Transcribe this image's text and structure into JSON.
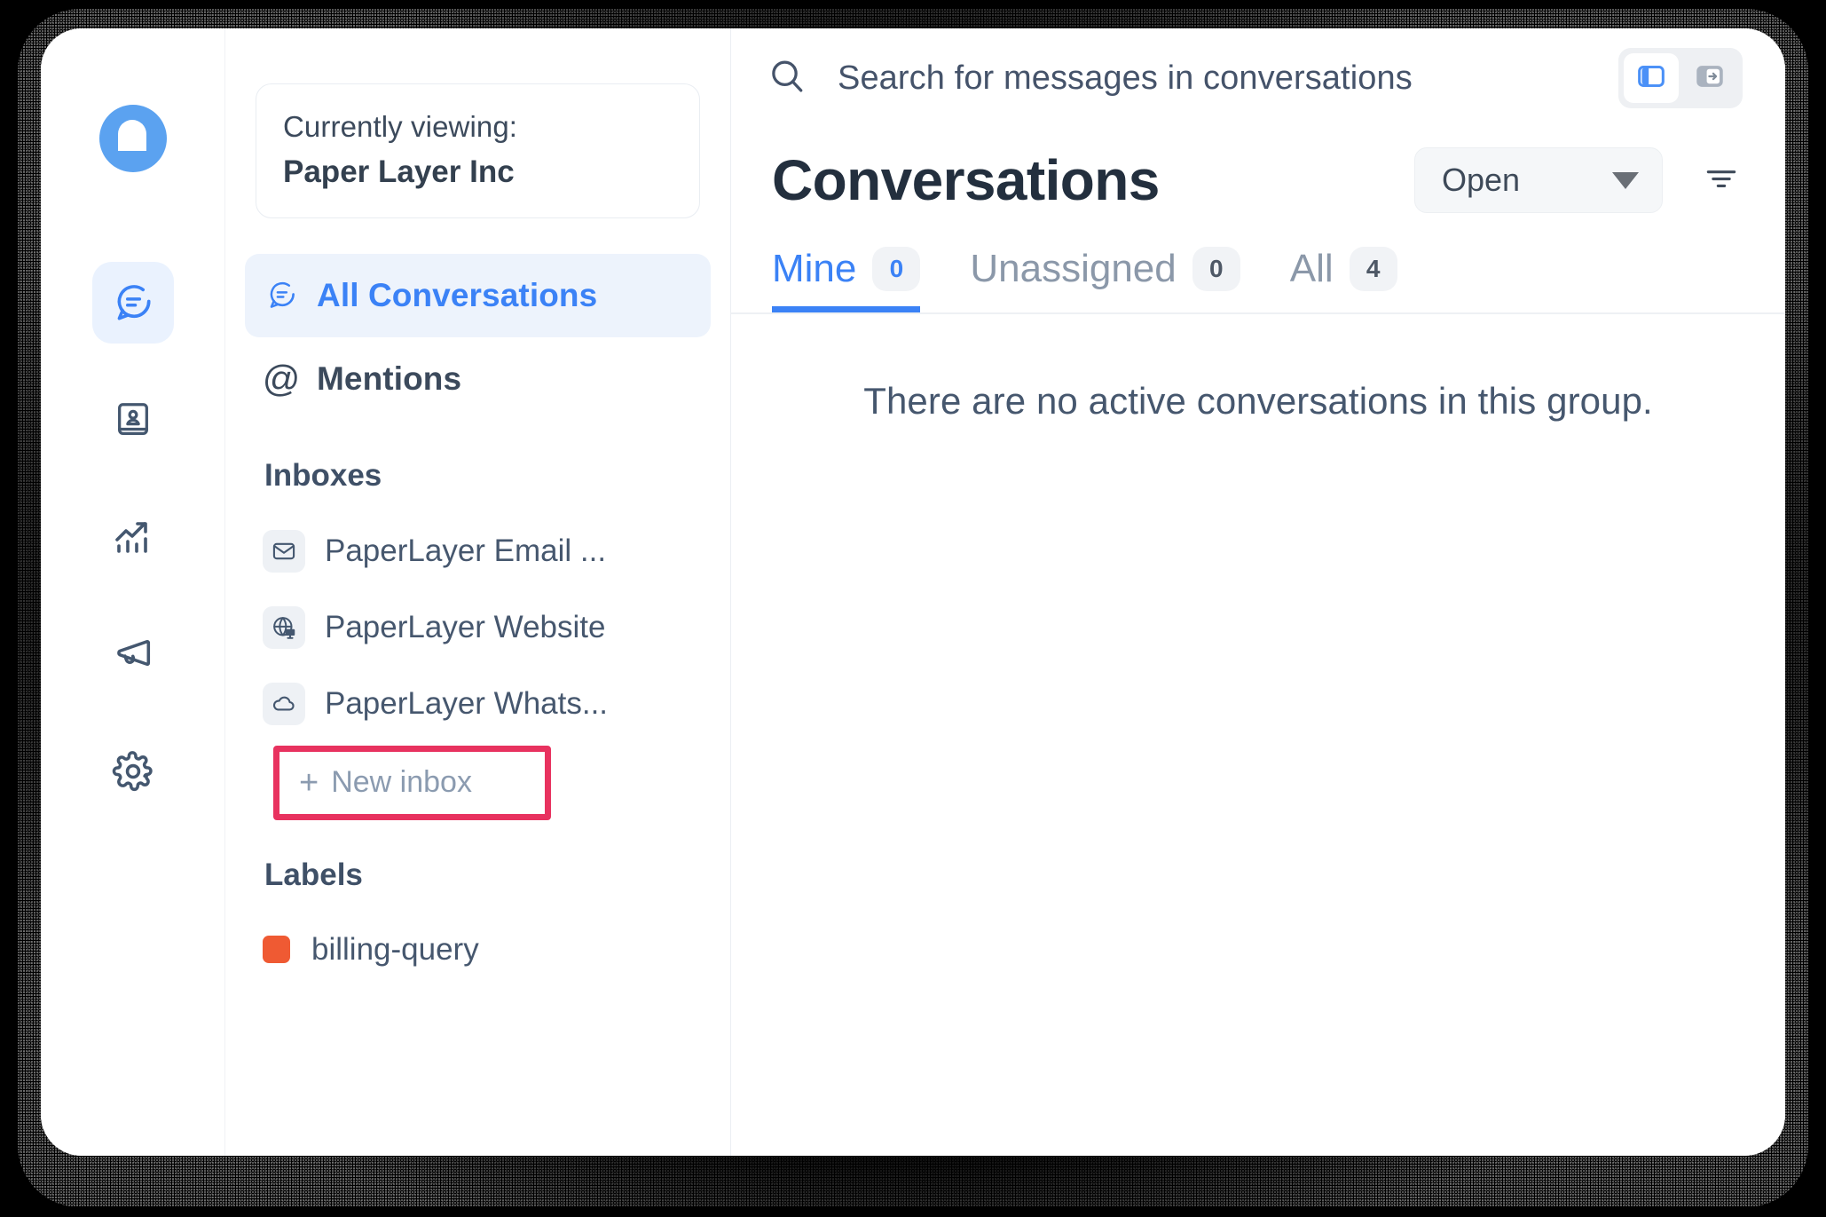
{
  "app": {
    "logo_icon": "paperlayer-chat-logo"
  },
  "nav_rail": {
    "items": [
      {
        "icon": "chat-bubble-icon",
        "name": "conversations",
        "active": true
      },
      {
        "icon": "contacts-book-icon",
        "name": "contacts",
        "active": false
      },
      {
        "icon": "reports-chart-icon",
        "name": "reports",
        "active": false
      },
      {
        "icon": "megaphone-icon",
        "name": "campaigns",
        "active": false
      },
      {
        "icon": "gear-icon",
        "name": "settings",
        "active": false
      }
    ]
  },
  "sidebar": {
    "viewing": {
      "label": "Currently viewing:",
      "account": "Paper Layer Inc"
    },
    "primary_nav": [
      {
        "icon": "chat-bubble-icon",
        "label": "All Conversations",
        "active": true
      },
      {
        "icon": "at-icon",
        "label": "Mentions",
        "active": false
      }
    ],
    "inboxes": {
      "title": "Inboxes",
      "items": [
        {
          "icon": "envelope-icon",
          "label": "PaperLayer Email ..."
        },
        {
          "icon": "globe-website-icon",
          "label": "PaperLayer Website"
        },
        {
          "icon": "cloud-icon",
          "label": "PaperLayer Whats..."
        }
      ],
      "new_inbox": {
        "plus": "+",
        "label": "New inbox",
        "highlight_color": "#e8325f"
      }
    },
    "labels": {
      "title": "Labels",
      "items": [
        {
          "name": "billing-query",
          "color": "#ef5a33"
        }
      ]
    }
  },
  "main": {
    "search": {
      "icon": "search-icon",
      "placeholder": "Search for messages in conversations"
    },
    "view_toggle": [
      {
        "icon": "panel-left-icon",
        "name": "split-view",
        "active": true
      },
      {
        "icon": "panel-expand-icon",
        "name": "expanded-view",
        "active": false
      }
    ],
    "title": "Conversations",
    "status_filter": {
      "value": "Open",
      "icon": "chevron-down-icon"
    },
    "filter_icon": "filter-lines-icon",
    "tabs": [
      {
        "label": "Mine",
        "count": "0",
        "active": true
      },
      {
        "label": "Unassigned",
        "count": "0",
        "active": false
      },
      {
        "label": "All",
        "count": "4",
        "active": false
      }
    ],
    "empty_state": "There are no active conversations in this group."
  },
  "colors": {
    "accent": "#3b82f6",
    "highlight": "#e8325f",
    "label_orange": "#ef5a33",
    "text_dark": "#232f3e",
    "text_muted": "#46576e"
  }
}
